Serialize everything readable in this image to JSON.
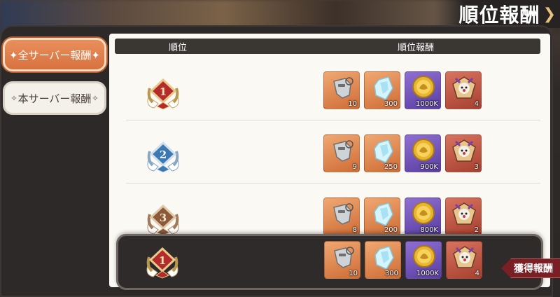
{
  "title": "順位報酬",
  "title_chevron": "❯",
  "tabs": [
    {
      "label": "✦全サーバー報酬✦",
      "selected": true
    },
    {
      "label": "本サーバー報酬",
      "selected": false
    }
  ],
  "table": {
    "header_rank": "順位",
    "header_reward": "順位報酬"
  },
  "rows": [
    {
      "rank": "1",
      "medal_color": "#b32b2b",
      "rewards": [
        "10",
        "300",
        "1000K",
        "4"
      ]
    },
    {
      "rank": "2",
      "medal_color": "#3d78b0",
      "rewards": [
        "9",
        "250",
        "900K",
        "3"
      ]
    },
    {
      "rank": "3",
      "medal_color": "#8a5a3a",
      "rewards": [
        "8",
        "200",
        "800K",
        "2"
      ]
    }
  ],
  "my_rank": {
    "rank": "1",
    "rewards": [
      "10",
      "300",
      "1000K",
      "4"
    ]
  },
  "claim_label": "獲得報酬",
  "reward_icons": [
    "whistle-icon",
    "crystal-icon",
    "gold-coin-icon",
    "jester-icon"
  ],
  "colors": {
    "accent": "#d8723f",
    "claim": "#7a1f24"
  }
}
